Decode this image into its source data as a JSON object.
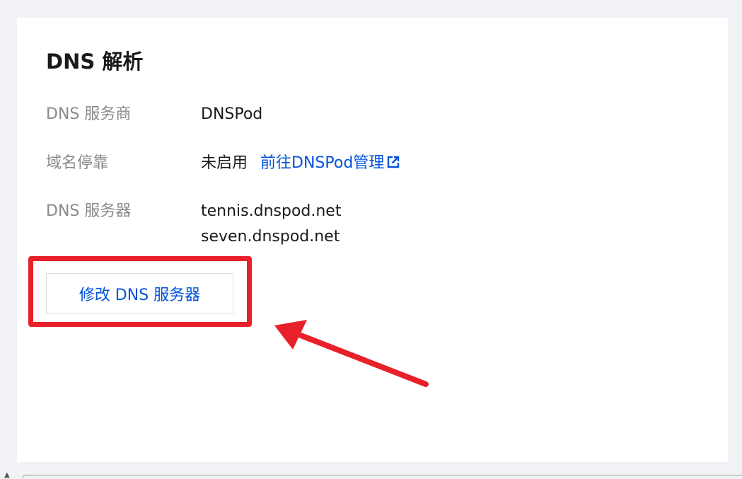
{
  "section": {
    "title": "DNS 解析"
  },
  "rows": [
    {
      "label": "DNS 服务商",
      "value": "DNSPod"
    },
    {
      "label": "域名停靠",
      "value": "未启用",
      "link": "前往DNSPod管理"
    },
    {
      "label": "DNS 服务器",
      "values": [
        "tennis.dnspod.net",
        "seven.dnspod.net"
      ]
    }
  ],
  "actions": {
    "edit_dns_label": "修改 DNS 服务器"
  },
  "icons": {
    "external_link": "external-link-icon"
  },
  "colors": {
    "link": "#0052d9",
    "annotation": "#e8202a",
    "label": "#8a8a8a",
    "text": "#1a1a1a"
  }
}
